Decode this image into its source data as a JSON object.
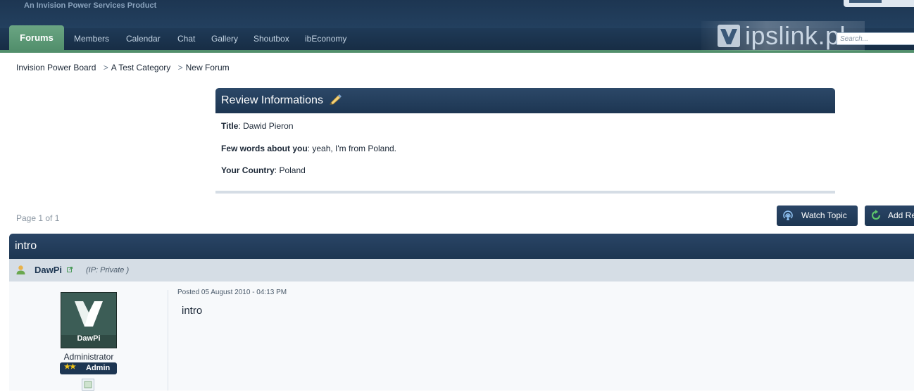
{
  "header": {
    "tagline": "An Invision Power Services Product",
    "logo_text": "ipslink.pl",
    "search_placeholder": "Search..."
  },
  "nav": {
    "tabs": [
      {
        "label": "Forums",
        "active": true
      },
      {
        "label": "Members"
      },
      {
        "label": "Calendar"
      },
      {
        "label": "Chat"
      },
      {
        "label": "Gallery"
      },
      {
        "label": "Shoutbox"
      },
      {
        "label": "ibEconomy"
      }
    ]
  },
  "breadcrumb": {
    "items": [
      "Invision Power Board",
      "A Test Category",
      "New Forum"
    ],
    "separator": ">"
  },
  "review": {
    "title": "Review Informations",
    "fields": [
      {
        "label": "Title",
        "value": ": Dawid Pieron"
      },
      {
        "label": "Few words about you",
        "value": ": yeah, I'm from Poland."
      },
      {
        "label": "Your Country",
        "value": ": Poland"
      }
    ]
  },
  "pagination": {
    "text": "Page 1 of 1"
  },
  "buttons": {
    "watch_topic": "Watch Topic",
    "add_reply": "Add Re"
  },
  "topic": {
    "title": "intro",
    "author": "DawPi",
    "ip": "(IP: Private )",
    "avatar_text": "DawPi",
    "role": "Administrator",
    "rank_stars": "★★",
    "rank": "Admin",
    "posted": "Posted 05 August 2010 - 04:13 PM",
    "body": "intro"
  },
  "colors": {
    "header_dark": "#1d3652",
    "active_tab": "#528f6c",
    "author_bar": "#d5dde5"
  }
}
